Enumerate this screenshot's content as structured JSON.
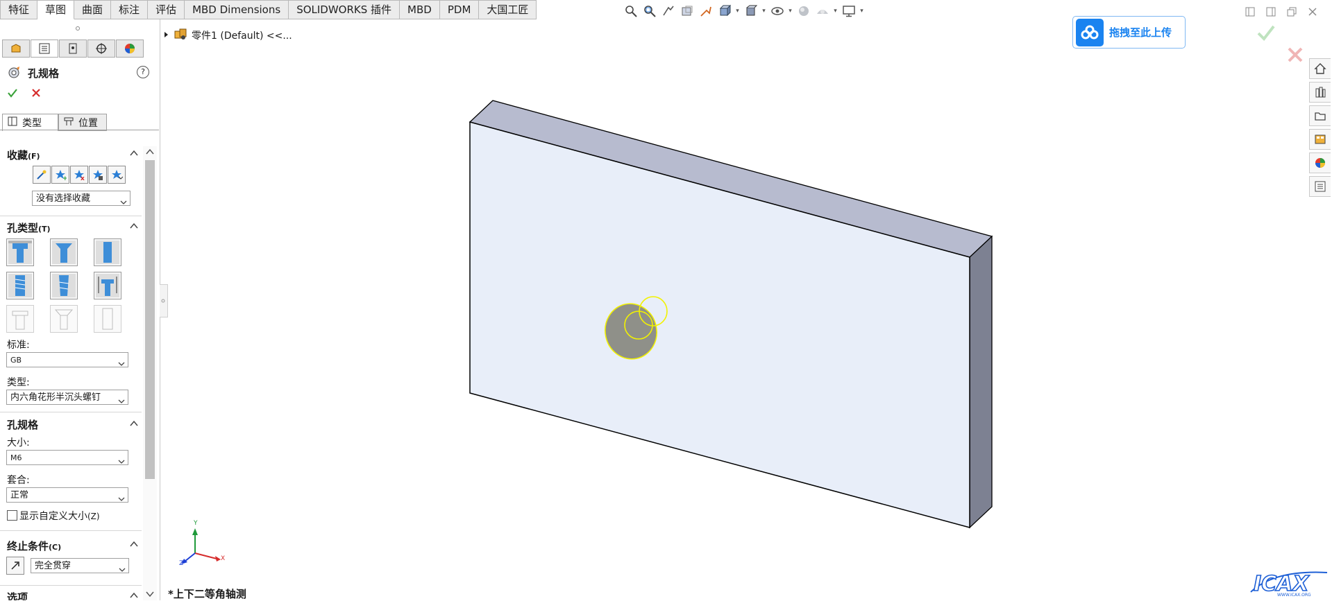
{
  "tabs": [
    "特征",
    "草图",
    "曲面",
    "标注",
    "评估",
    "MBD Dimensions",
    "SOLIDWORKS 插件",
    "MBD",
    "PDM",
    "大国工匠"
  ],
  "tabs_active_index": 1,
  "hud_icons": [
    "zoom-to-fit-icon",
    "zoom-area-icon",
    "previous-view-icon",
    "section-view-icon",
    "dynamic-annotation-icon",
    "view-orientation-icon",
    "display-style-icon",
    "hide-show-icon",
    "edit-appearance-icon",
    "apply-scene-icon",
    "view-settings-icon"
  ],
  "tree": {
    "item": "零件1 (Default) <<..."
  },
  "pm": {
    "title": "孔规格",
    "help": "?",
    "tabs": {
      "type": "类型",
      "position": "位置"
    },
    "favorites": {
      "title": "收藏",
      "hotkey": "(F)",
      "selection": "没有选择收藏"
    },
    "hole_type": {
      "title": "孔类型",
      "hotkey": "(T)"
    },
    "standard": {
      "label": "标准:",
      "value": "GB"
    },
    "type": {
      "label": "类型:",
      "value": "内六角花形半沉头螺钉"
    },
    "hole_spec": {
      "title": "孔规格"
    },
    "size": {
      "label": "大小:",
      "value": "M6"
    },
    "fit": {
      "label": "套合:",
      "value": "正常"
    },
    "custom_size": {
      "label": "显示自定义大小",
      "hotkey": "(Z)",
      "checked": false
    },
    "end_condition": {
      "title": "终止条件",
      "hotkey": "(C)",
      "value": "完全贯穿"
    },
    "options": {
      "title": "选项"
    }
  },
  "viewport": {
    "view_name": "*上下二等角轴测",
    "triad": {
      "x": "X",
      "y": "Y",
      "z": "Z"
    }
  },
  "upload": {
    "label": "拖拽至此上传"
  },
  "watermark": "ICAX",
  "colors": {
    "front_face": "#e8eef9",
    "top_face": "#b7bbcf",
    "side_face": "#7d8192",
    "preview": "#f2f200",
    "accept": "#3aa23a",
    "cancel": "#d62c2c",
    "upload_blue": "#1a83f0"
  }
}
